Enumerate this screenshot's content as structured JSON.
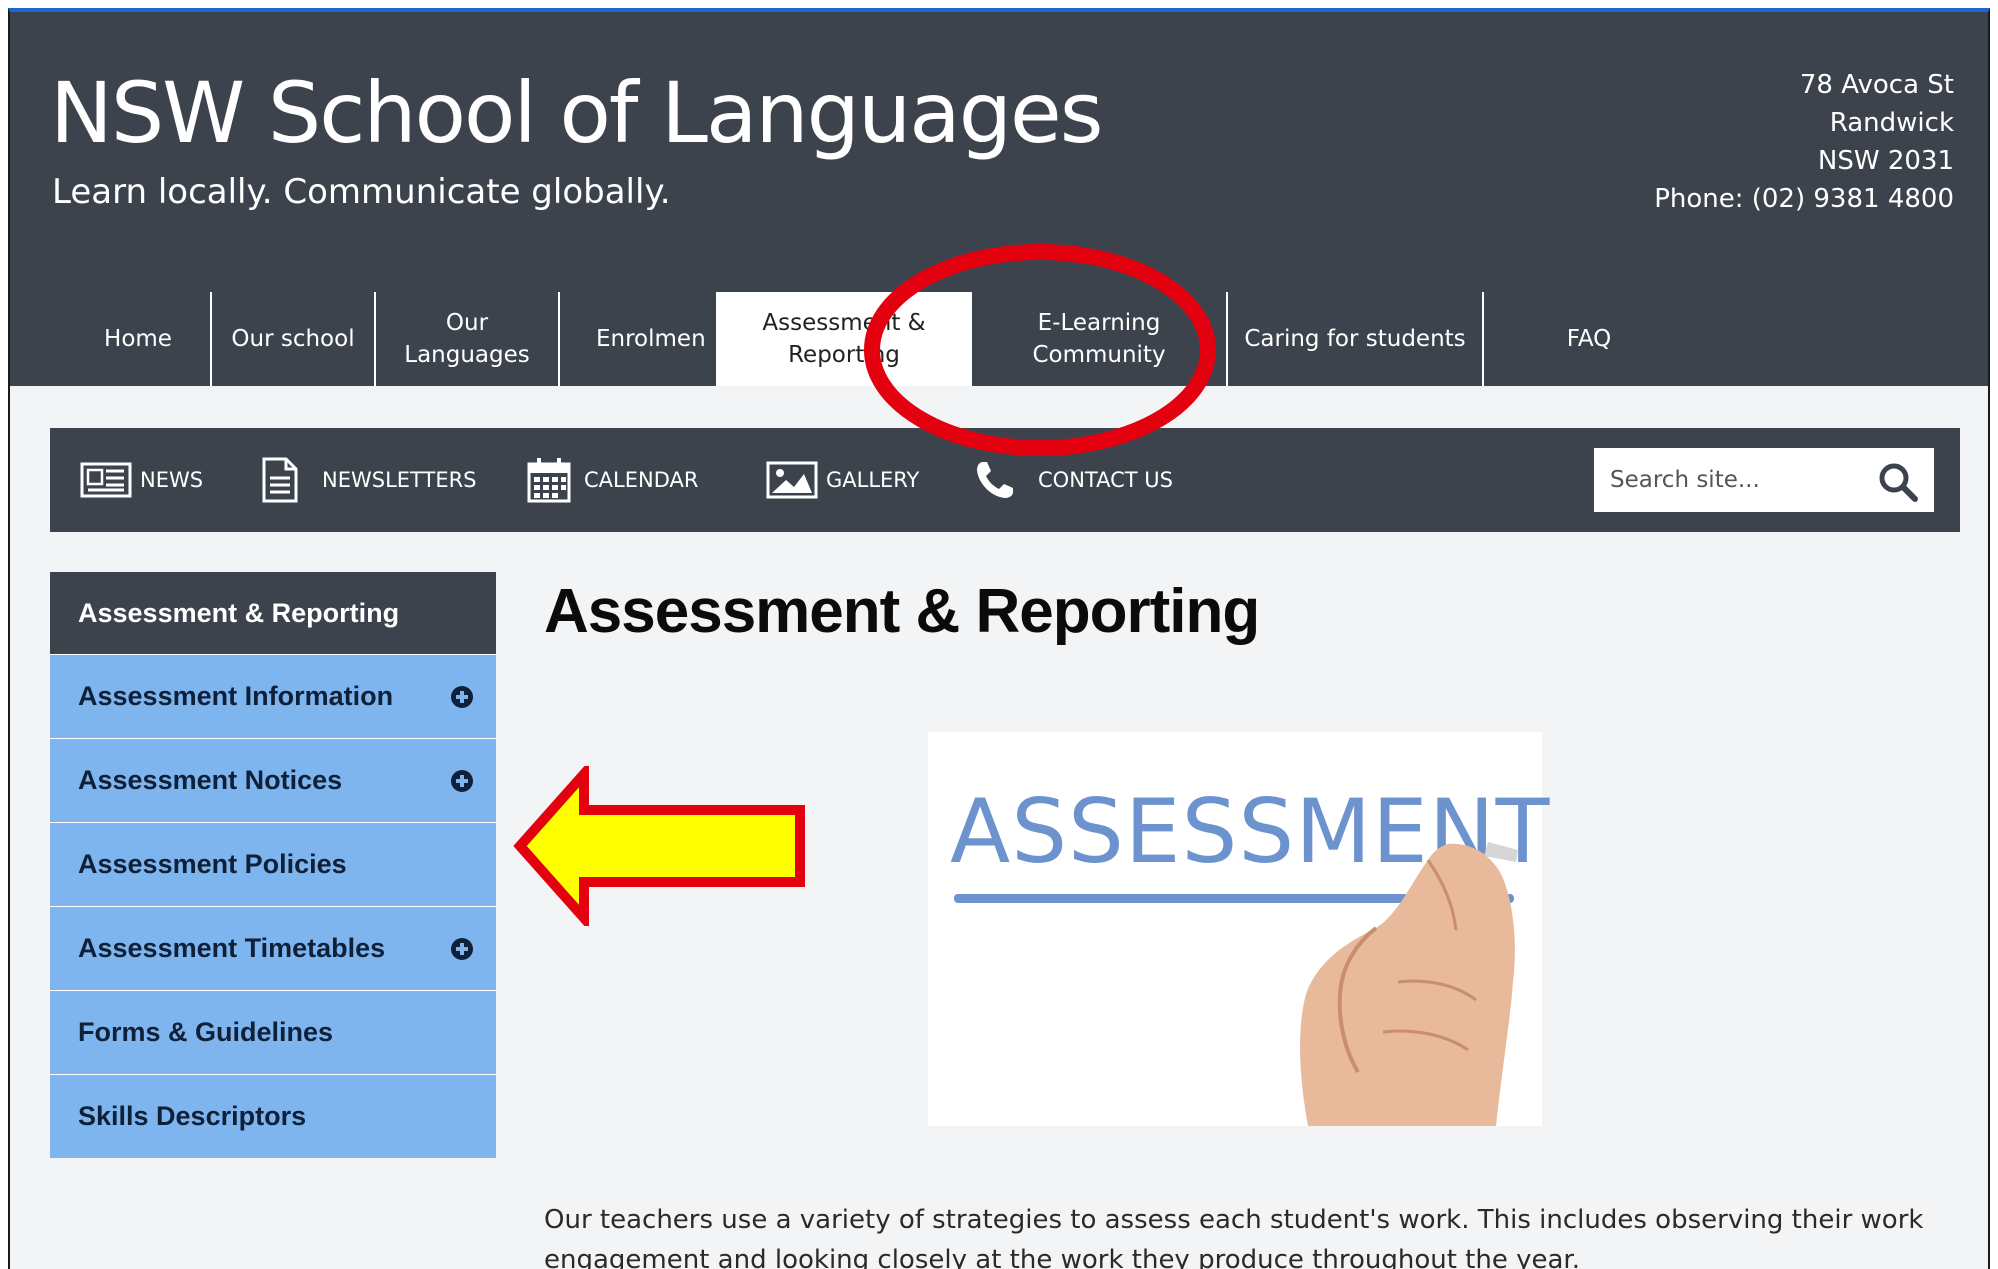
{
  "header": {
    "title": "NSW School of Languages",
    "tagline": "Learn locally. Communicate globally.",
    "address": [
      "78 Avoca St",
      "Randwick",
      "NSW 2031",
      "Phone: (02) 9381 4800"
    ]
  },
  "main_nav": [
    {
      "label": "Home"
    },
    {
      "label": "Our school"
    },
    {
      "label": "Our Languages"
    },
    {
      "label": "Enrolmen"
    },
    {
      "label": "Assessment & Reporting",
      "active": true
    },
    {
      "label": "E-Learning Community"
    },
    {
      "label": "Caring for students"
    },
    {
      "label": "FAQ"
    }
  ],
  "util_nav": [
    {
      "label": "NEWS",
      "icon": "news-icon"
    },
    {
      "label": "NEWSLETTERS",
      "icon": "document-icon"
    },
    {
      "label": "CALENDAR",
      "icon": "calendar-icon"
    },
    {
      "label": "GALLERY",
      "icon": "image-icon"
    },
    {
      "label": "CONTACT US",
      "icon": "phone-icon"
    }
  ],
  "search": {
    "placeholder": "Search site...",
    "icon": "search-icon"
  },
  "sidebar": {
    "heading": "Assessment & Reporting",
    "items": [
      {
        "label": "Assessment Information",
        "expandable": true
      },
      {
        "label": "Assessment Notices",
        "expandable": true
      },
      {
        "label": "Assessment Policies",
        "expandable": false
      },
      {
        "label": "Assessment Timetables",
        "expandable": true
      },
      {
        "label": "Forms & Guidelines",
        "expandable": false
      },
      {
        "label": "Skills Descriptors",
        "expandable": false
      }
    ]
  },
  "content": {
    "heading": "Assessment & Reporting",
    "image_text": "ASSESSMENT",
    "intro": "Our teachers use a variety of strategies to assess each student's work. This includes observing their work engagement and looking closely at the work they produce throughout the year."
  },
  "colors": {
    "header_bg": "#3d434c",
    "sidebar_item_bg": "#7fb5ef",
    "annotation_red": "#e3000f",
    "annotation_yellow": "#ffff00"
  }
}
